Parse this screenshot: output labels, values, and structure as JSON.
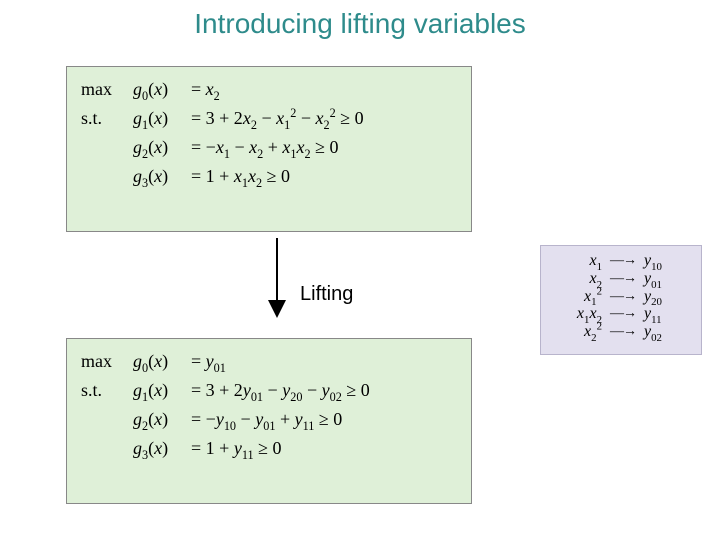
{
  "title": "Introducing lifting variables",
  "lifting_label": "Lifting",
  "top_box": {
    "rows": [
      {
        "lead": "max",
        "fn_html": "<span class='ital'>g</span><sub>0</sub>(<span class='ital'>x</span>)",
        "rest_html": "= <span class='ital'>x</span><sub>2</sub>"
      },
      {
        "lead": "s.t.",
        "fn_html": "<span class='ital'>g</span><sub>1</sub>(<span class='ital'>x</span>)",
        "rest_html": "= 3 + 2<span class='ital'>x</span><sub>2</sub> − <span class='ital'>x</span><sub>1</sub><sup>2</sup> − <span class='ital'>x</span><sub>2</sub><sup>2</sup> ≥ 0"
      },
      {
        "lead": "",
        "fn_html": "<span class='ital'>g</span><sub>2</sub>(<span class='ital'>x</span>)",
        "rest_html": "= −<span class='ital'>x</span><sub>1</sub> − <span class='ital'>x</span><sub>2</sub> + <span class='ital'>x</span><sub>1</sub><span class='ital'>x</span><sub>2</sub> ≥ 0"
      },
      {
        "lead": "",
        "fn_html": "<span class='ital'>g</span><sub>3</sub>(<span class='ital'>x</span>)",
        "rest_html": "= 1 + <span class='ital'>x</span><sub>1</sub><span class='ital'>x</span><sub>2</sub> ≥ 0"
      }
    ]
  },
  "bottom_box": {
    "rows": [
      {
        "lead": "max",
        "fn_html": "<span class='ital'>g</span><sub>0</sub>(<span class='ital'>x</span>)",
        "rest_html": "= <span class='ital'>y</span><sub>01</sub>"
      },
      {
        "lead": "s.t.",
        "fn_html": "<span class='ital'>g</span><sub>1</sub>(<span class='ital'>x</span>)",
        "rest_html": "= 3 + 2<span class='ital'>y</span><sub>01</sub> − <span class='ital'>y</span><sub>20</sub> − <span class='ital'>y</span><sub>02</sub> ≥ 0"
      },
      {
        "lead": "",
        "fn_html": "<span class='ital'>g</span><sub>2</sub>(<span class='ital'>x</span>)",
        "rest_html": "= −<span class='ital'>y</span><sub>10</sub> − <span class='ital'>y</span><sub>01</sub> + <span class='ital'>y</span><sub>11</sub> ≥ 0"
      },
      {
        "lead": "",
        "fn_html": "<span class='ital'>g</span><sub>3</sub>(<span class='ital'>x</span>)",
        "rest_html": "= 1 + <span class='ital'>y</span><sub>11</sub> ≥ 0"
      }
    ]
  },
  "map_box": {
    "rows": [
      {
        "lhs_html": "<span class='ital'>x</span><sub>1</sub>",
        "rhs_html": "<span class='ital'>y</span><sub>10</sub>"
      },
      {
        "lhs_html": "<span class='ital'>x</span><sub>2</sub>",
        "rhs_html": "<span class='ital'>y</span><sub>01</sub>"
      },
      {
        "lhs_html": "<span class='ital'>x</span><sub>1</sub><sup>2</sup>",
        "rhs_html": "<span class='ital'>y</span><sub>20</sub>"
      },
      {
        "lhs_html": "<span class='ital'>x</span><sub>1</sub><span class='ital'>x</span><sub>2</sub>",
        "rhs_html": "<span class='ital'>y</span><sub>11</sub>"
      },
      {
        "lhs_html": "<span class='ital'>x</span><sub>2</sub><sup>2</sup>",
        "rhs_html": "<span class='ital'>y</span><sub>02</sub>"
      }
    ],
    "arrow": "—→"
  }
}
